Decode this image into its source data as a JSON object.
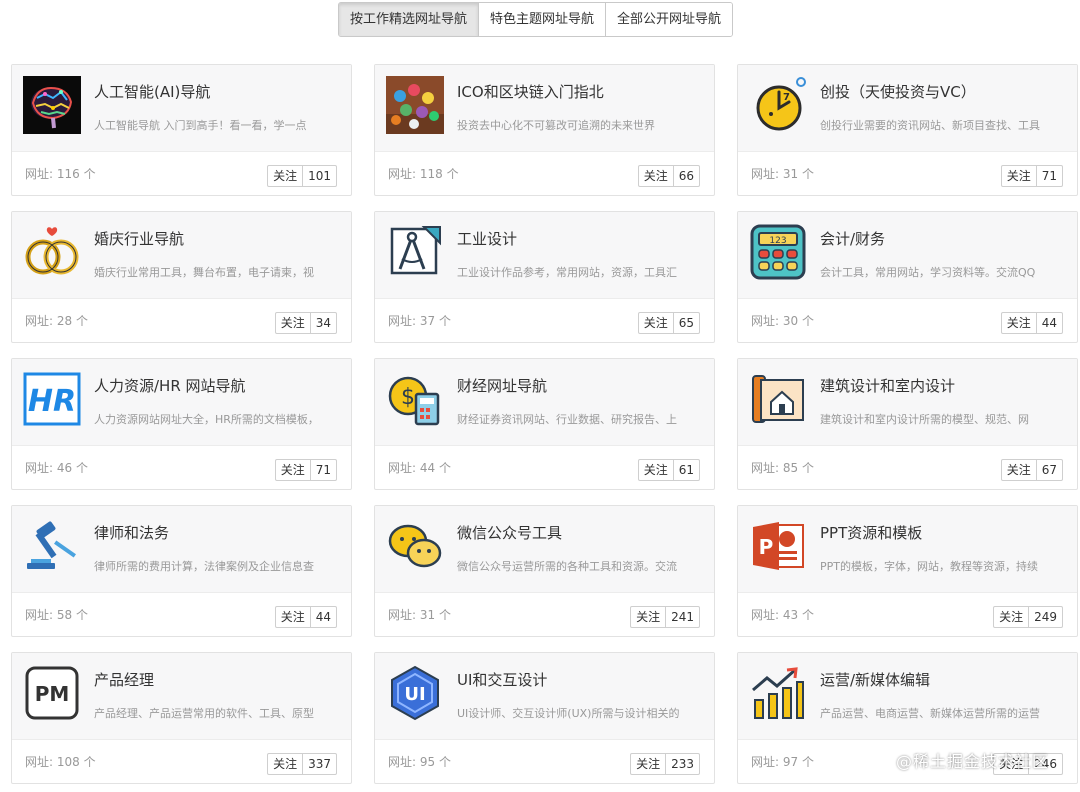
{
  "tabs": [
    "按工作精选网址导航",
    "特色主题网址导航",
    "全部公开网址导航"
  ],
  "follow_label": "关注",
  "cards": [
    {
      "title": "人工智能(AI)导航",
      "desc": "人工智能导航 入门到高手！看一看，学一点",
      "count": "网址: 116 个",
      "follows": "101",
      "icon": "ai-brain-icon"
    },
    {
      "title": "ICO和区块链入门指北",
      "desc": "投资去中心化不可篡改可追溯的未来世界",
      "count": "网址: 118 个",
      "follows": "66",
      "icon": "blockchain-icon"
    },
    {
      "title": "创投（天使投资与VC）",
      "desc": "创投行业需要的资讯网站、新项目查找、工具",
      "count": "网址: 31 个",
      "follows": "71",
      "icon": "clock-icon"
    },
    {
      "title": "婚庆行业导航",
      "desc": "婚庆行业常用工具，舞台布置，电子请柬，视",
      "count": "网址: 28 个",
      "follows": "34",
      "icon": "wedding-rings-icon"
    },
    {
      "title": "工业设计",
      "desc": "工业设计作品参考，常用网站，资源，工具汇",
      "count": "网址: 37 个",
      "follows": "65",
      "icon": "compass-ruler-icon"
    },
    {
      "title": "会计/财务",
      "desc": "会计工具，常用网站，学习资料等。交流QQ",
      "count": "网址: 30 个",
      "follows": "44",
      "icon": "calculator-icon"
    },
    {
      "title": "人力资源/HR 网站导航",
      "desc": "人力资源网站网址大全，HR所需的文档模板，",
      "count": "网址: 46 个",
      "follows": "71",
      "icon": "hr-icon"
    },
    {
      "title": "财经网址导航",
      "desc": "财经证券资讯网站、行业数据、研究报告、上",
      "count": "网址: 44 个",
      "follows": "61",
      "icon": "finance-icon"
    },
    {
      "title": "建筑设计和室内设计",
      "desc": "建筑设计和室内设计所需的模型、规范、网",
      "count": "网址: 85 个",
      "follows": "67",
      "icon": "blueprint-icon"
    },
    {
      "title": "律师和法务",
      "desc": "律师所需的费用计算，法律案例及企业信息查",
      "count": "网址: 58 个",
      "follows": "44",
      "icon": "gavel-icon"
    },
    {
      "title": "微信公众号工具",
      "desc": "微信公众号运营所需的各种工具和资源。交流",
      "count": "网址: 31 个",
      "follows": "241",
      "icon": "wechat-icon"
    },
    {
      "title": "PPT资源和模板",
      "desc": "PPT的模板，字体，网站，教程等资源，持续",
      "count": "网址: 43 个",
      "follows": "249",
      "icon": "powerpoint-icon"
    },
    {
      "title": "产品经理",
      "desc": "产品经理、产品运营常用的软件、工具、原型",
      "count": "网址: 108 个",
      "follows": "337",
      "icon": "pm-icon"
    },
    {
      "title": "UI和交互设计",
      "desc": "UI设计师、交互设计师(UX)所需与设计相关的",
      "count": "网址: 95 个",
      "follows": "233",
      "icon": "ui-hexagon-icon"
    },
    {
      "title": "运营/新媒体编辑",
      "desc": "产品运营、电商运营、新媒体运营所需的运营",
      "count": "网址: 97 个",
      "follows": "246",
      "icon": "growth-chart-icon"
    }
  ],
  "watermark": "@稀土掘金技术社区"
}
